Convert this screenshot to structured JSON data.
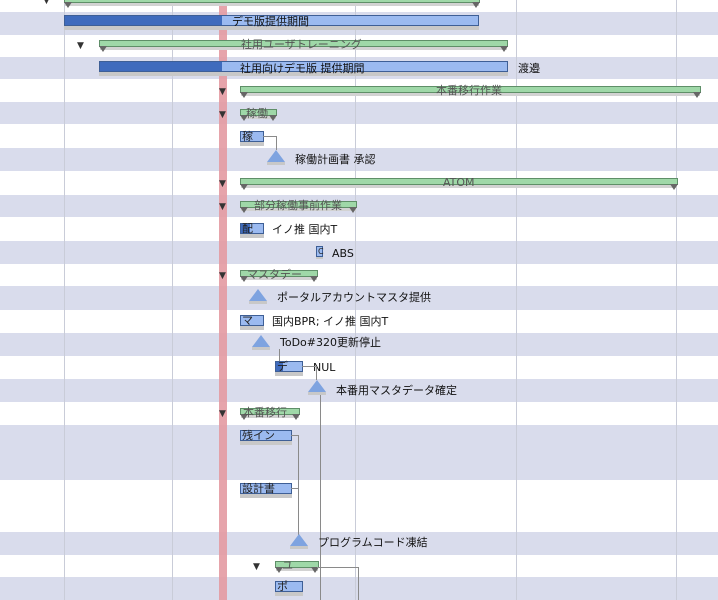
{
  "gantt": {
    "rows": {
      "r0_summary": "",
      "r1_task": "デモ版提供期間",
      "r2_summary": "社用ユーザトレーニング",
      "r3_task": "社用向けデモ版 提供期間",
      "r3_resource": "渡邉",
      "r4_summary": "本番移行作業",
      "r5_summary": "稼働",
      "r6_task": "稼",
      "r7_milestone": "稼働計画書 承認",
      "r8_summary": "ATOM",
      "r9_summary": "部分稼働事前作業",
      "r10_task": "配",
      "r10_resource": "イノ推 国内T",
      "r11_task": "C",
      "r11_resource": "ABS",
      "r12_summary": "マスタデー",
      "r13_milestone": "ポータルアカウントマスタ提供",
      "r14_task": "マ",
      "r14_resource": "国内BPR; イノ推 国内T",
      "r15_milestone": "ToDo#320更新停止",
      "r16_task": "デ",
      "r16_resource": "NUL",
      "r17_milestone": "本番用マスタデータ確定",
      "r18_summary": "本番移行",
      "r19_task": "残イン",
      "r20_task": "設計書",
      "r21_milestone": "プログラムコード凍結",
      "r22_summary": "ユ",
      "r23_task": "ポ"
    },
    "colors": {
      "task_fill": "#9bbaf0",
      "task_progress": "#3f6bbd",
      "summary_fill": "#9fd8a8",
      "today_line": "#e39aa2",
      "row_alt": "#d9dcec"
    }
  }
}
